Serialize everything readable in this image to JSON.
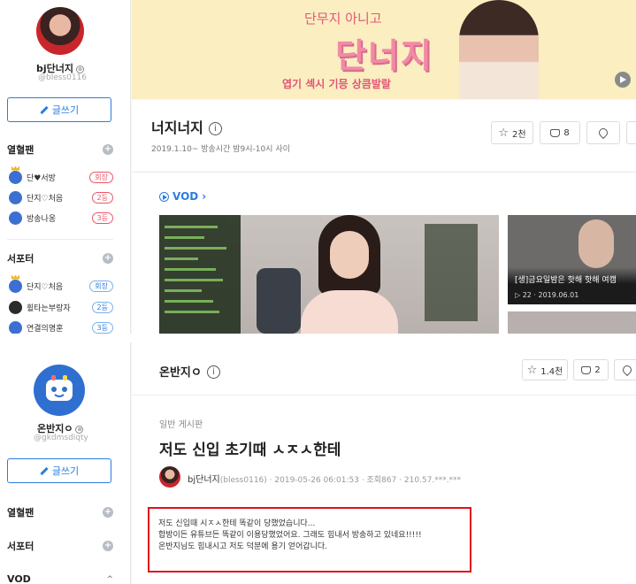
{
  "top": {
    "streamer": {
      "name": "bj단너지",
      "id": "@bless0116",
      "lock_glyph": "⊚"
    },
    "write_button": "글쓰기",
    "fan_section": {
      "title": "열혈팬",
      "items": [
        {
          "name": "단♥서방",
          "badge": "회장"
        },
        {
          "name": "단지♡처음",
          "badge": "2등"
        },
        {
          "name": "방송나옹",
          "badge": "3등"
        }
      ]
    },
    "supporter_section": {
      "title": "서포터",
      "items": [
        {
          "name": "단지♡처음",
          "badge": "회장"
        },
        {
          "name": "휠타는부랑자",
          "badge": "2등"
        },
        {
          "name": "연결의명훈",
          "badge": "3등"
        }
      ]
    },
    "banner": {
      "line1": "단무지 아니고",
      "title": "단너지",
      "subtitle": "엽기 섹시 기믕 상큼발랄"
    },
    "station": {
      "title": "너지너지",
      "desc": "2019.1.10~ 방송시간 밤9시-10시 사이",
      "favorite": "2천",
      "cup": "8"
    },
    "vod": {
      "label": "VOD",
      "arrow": "›",
      "side_title": "[생]금요일밤은 핫해 핫해 여캠",
      "side_meta": "▷ 22 · 2019.06.01"
    }
  },
  "bottom": {
    "streamer": {
      "name": "온반지ㅇ",
      "id": "@gkdmsdlqty",
      "lock_glyph": "⊚"
    },
    "write_button": "글쓰기",
    "fan_title": "열혈팬",
    "supporter_title": "서포터",
    "vod_title": "VOD",
    "station": {
      "title": "온반지ㅇ",
      "favorite": "1.4천",
      "cup": "2"
    },
    "post": {
      "category": "일반 게시판",
      "title": "저도 신입 초기때 ㅅㅈㅅ한테",
      "author": "bj단너지",
      "author_id": "(bless0116)",
      "meta": "· 2019-05-26 06:01:53 · 조회867 · 210.57.***.***",
      "body": [
        "저도 신입때 시ㅈㅅ한테 똑같이 당했었습니다...",
        "합방이든 유튜브든 똑같이 이용당했었어요. 그래도 힘내서 방송하고 있네요!!!!!",
        "온반지님도 힘내시고 저도 덕분에 용기 얻어갑니다."
      ]
    }
  },
  "colors": {
    "accent": "#2a7de1",
    "highlight_border": "#e0121e",
    "banner_bg": "#fbeec0"
  }
}
